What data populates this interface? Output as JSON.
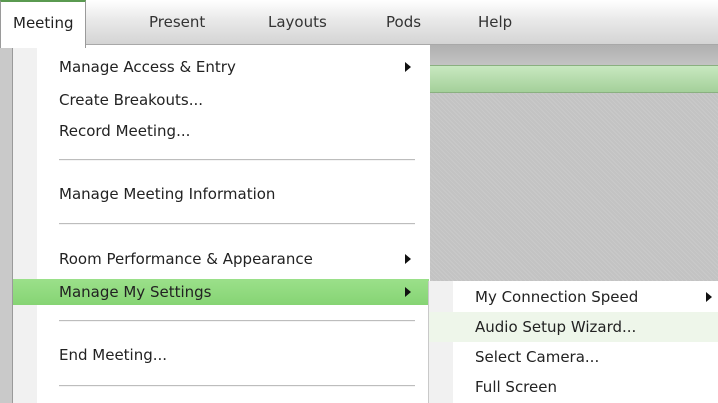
{
  "menubar": {
    "items": [
      {
        "label": "Meeting",
        "active": true
      },
      {
        "label": "Present"
      },
      {
        "label": "Layouts"
      },
      {
        "label": "Pods"
      },
      {
        "label": "Help"
      }
    ]
  },
  "meeting_menu": {
    "items": [
      {
        "label": "Manage Access & Entry",
        "submenu": true
      },
      {
        "label": "Create Breakouts..."
      },
      {
        "label": "Record Meeting..."
      },
      {
        "label": "Manage Meeting Information"
      },
      {
        "label": "Room Performance & Appearance",
        "submenu": true
      },
      {
        "label": "Manage My Settings",
        "submenu": true,
        "highlighted": true
      },
      {
        "label": "End Meeting..."
      }
    ]
  },
  "settings_submenu": {
    "items": [
      {
        "label": "My Connection Speed",
        "submenu": true
      },
      {
        "label": "Audio Setup Wizard...",
        "hovered": true
      },
      {
        "label": "Select Camera..."
      },
      {
        "label": "Full Screen"
      }
    ]
  },
  "colors": {
    "highlight": "#8fd87d",
    "hover": "#eef6ea",
    "titlebar": "#b4dca9"
  }
}
